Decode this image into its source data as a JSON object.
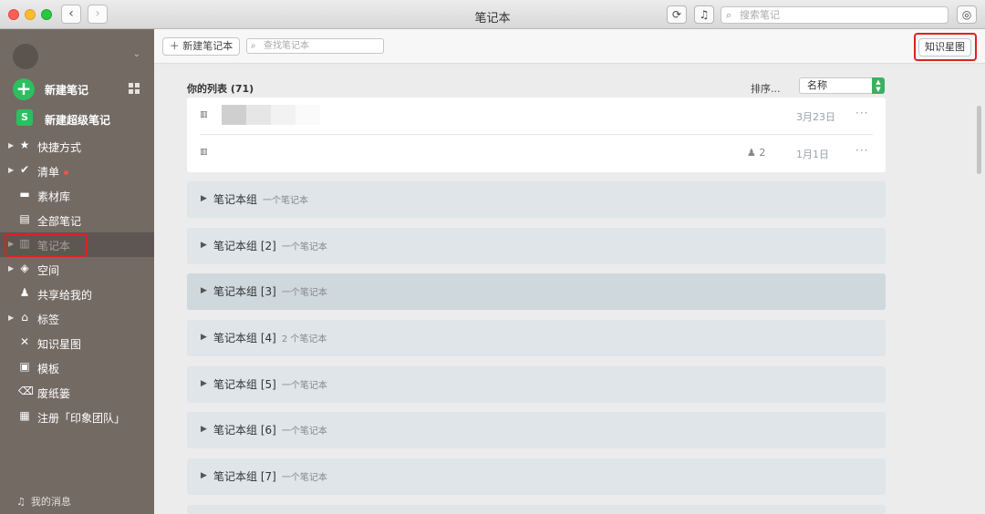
{
  "window": {
    "title": "笔记本",
    "search_placeholder": "搜索笔记"
  },
  "sidebar": {
    "new_note": "新建笔记",
    "new_super_note": "新建超级笔记",
    "items": [
      {
        "label": "快捷方式",
        "icon": "star-icon",
        "expandable": true
      },
      {
        "label": "清单",
        "icon": "check-circle-icon",
        "expandable": true,
        "badge": "red-dot"
      },
      {
        "label": "素材库",
        "icon": "library-icon",
        "expandable": false
      },
      {
        "label": "全部笔记",
        "icon": "note-icon",
        "expandable": false
      },
      {
        "label": "笔记本",
        "icon": "notebook-icon",
        "expandable": true,
        "active": true
      },
      {
        "label": "空间",
        "icon": "space-cube-icon",
        "expandable": true
      },
      {
        "label": "共享给我的",
        "icon": "people-icon",
        "expandable": false
      },
      {
        "label": "标签",
        "icon": "tag-icon",
        "expandable": true
      },
      {
        "label": "知识星图",
        "icon": "graph-icon",
        "expandable": false
      },
      {
        "label": "模板",
        "icon": "template-icon",
        "expandable": false
      },
      {
        "label": "废纸篓",
        "icon": "trash-icon",
        "expandable": false
      },
      {
        "label": "注册「印象团队」",
        "icon": "team-icon",
        "expandable": false
      }
    ],
    "messages": "我的消息"
  },
  "toolbar": {
    "new_notebook": "新建笔记本",
    "search_placeholder": "查找笔记本",
    "knowledge_graph": "知识星图"
  },
  "list": {
    "header": "你的列表 (71)",
    "sort_label": "排序...",
    "sort_value": "名称",
    "notes": [
      {
        "date": "3月23日",
        "shared": "",
        "more": "···"
      },
      {
        "date": "1月1日",
        "shared": "2",
        "more": "···"
      }
    ],
    "groups": [
      {
        "name": "笔记本组",
        "count": "一个笔记本"
      },
      {
        "name": "笔记本组 [2]",
        "count": "一个笔记本"
      },
      {
        "name": "笔记本组 [3]",
        "count": "一个笔记本"
      },
      {
        "name": "笔记本组 [4]",
        "count": "2 个笔记本"
      },
      {
        "name": "笔记本组 [5]",
        "count": "一个笔记本"
      },
      {
        "name": "笔记本组 [6]",
        "count": "一个笔记本"
      },
      {
        "name": "笔记本组 [7]",
        "count": "一个笔记本"
      }
    ]
  },
  "colors": {
    "accent": "#2dbe60",
    "sidebar_bg": "#736a64",
    "highlight": "#e02020",
    "group_bg": "#dfe5e8"
  }
}
